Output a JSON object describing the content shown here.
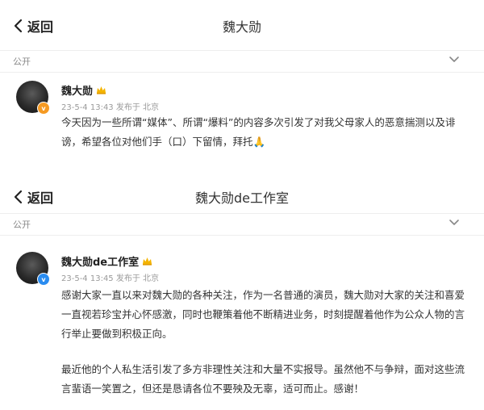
{
  "screens": [
    {
      "nav": {
        "back_label": "返回",
        "title": "魏大勋"
      },
      "visibility": "公开",
      "post": {
        "author": "魏大勋",
        "meta": "23-5-4 13:43 发布于 北京",
        "paragraphs": [
          "今天因为一些所谓“媒体”、所谓“爆料”的内容多次引发了对我父母家人的恶意揣测以及诽谤，希望各位对他们手（口）下留情，拜托🙏"
        ]
      }
    },
    {
      "nav": {
        "back_label": "返回",
        "title": "魏大勋de工作室"
      },
      "visibility": "公开",
      "post": {
        "author": "魏大勋de工作室",
        "meta": "23-5-4 13:45 发布于 北京",
        "paragraphs": [
          "感谢大家一直以来对魏大勋的各种关注，作为一名普通的演员，魏大勋对大家的关注和喜爱一直视若珍宝并心怀感激，同时也鞭策着他不断精进业务，时刻提醒着他作为公众人物的言行举止要做到积极正向。",
          "最近他的个人私生活引发了多方非理性关注和大量不实报导。虽然他不与争辩，面对这些流言蜚语一笑置之，但还是恳请各位不要殃及无辜，适可而止。感谢！"
        ]
      }
    }
  ],
  "icons": {
    "back": "chevron-left-icon",
    "dropdown": "chevron-down-icon",
    "crown": "crown-icon",
    "badge_1": "verified-badge-orange",
    "badge_2": "verified-badge-blue"
  },
  "colors": {
    "badge_orange": "#f59a23",
    "badge_blue": "#2a8cf0",
    "crown": "#f4b400",
    "meta_text": "#9a9a9a"
  }
}
